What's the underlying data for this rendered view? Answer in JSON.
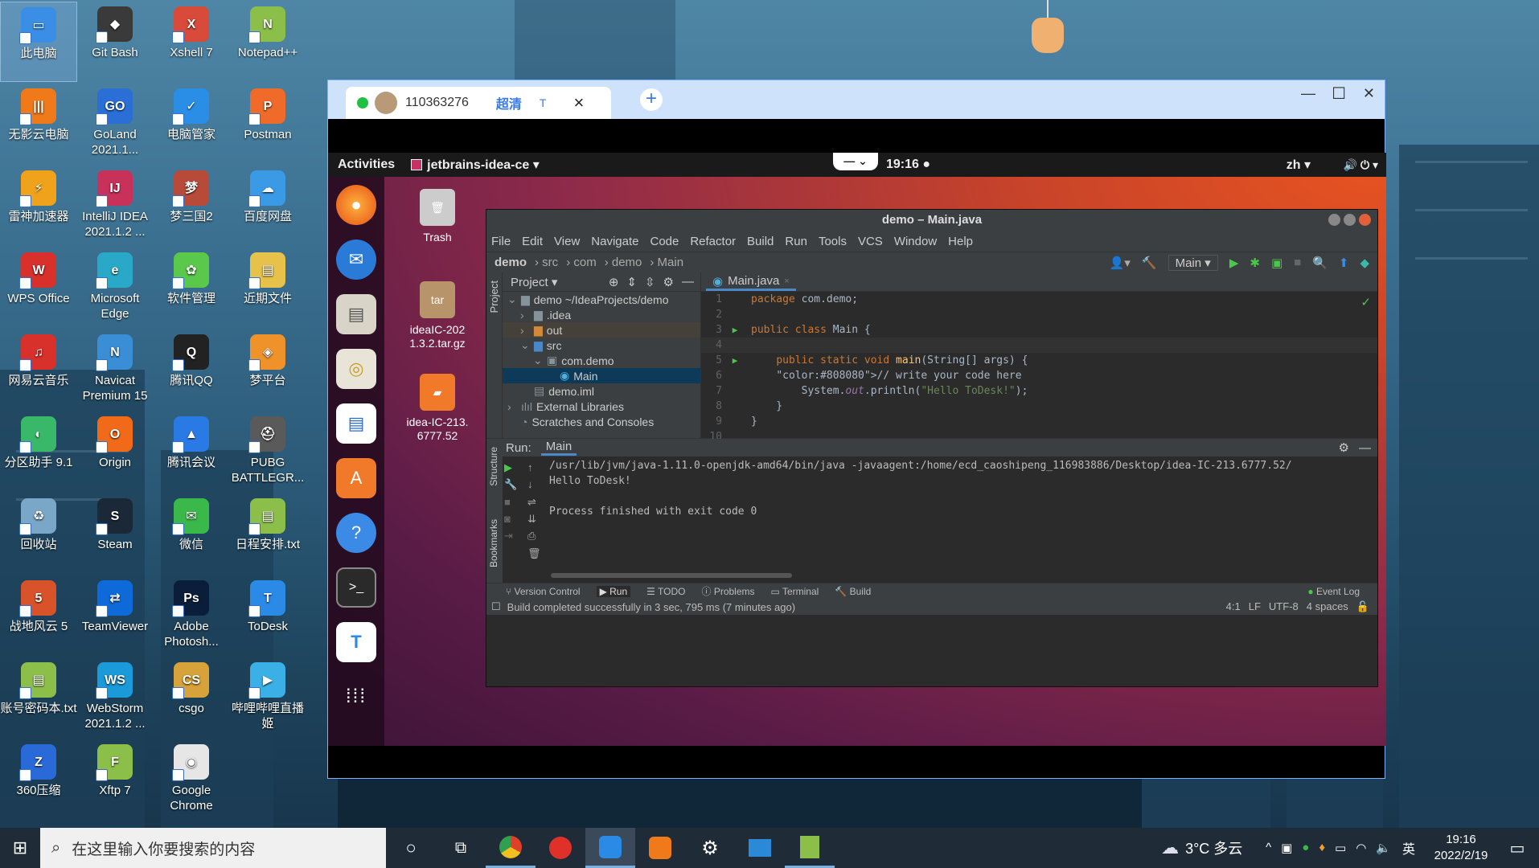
{
  "desktop": {
    "icons": [
      {
        "label": "此电脑",
        "color": "#3a8ee6",
        "glyph": "▭"
      },
      {
        "label": "Git Bash",
        "color": "#3a3a3a",
        "glyph": "◆"
      },
      {
        "label": "Xshell 7",
        "color": "#d84a3a",
        "glyph": "X"
      },
      {
        "label": "Notepad++",
        "color": "#8bbf4a",
        "glyph": "N"
      },
      {
        "label": "无影云电脑",
        "color": "#f07a1a",
        "glyph": "|||"
      },
      {
        "label": "GoLand 2021.1...",
        "color": "#2a6fd6",
        "glyph": "GO"
      },
      {
        "label": "电脑管家",
        "color": "#2a8ee6",
        "glyph": "✓"
      },
      {
        "label": "Postman",
        "color": "#f06a2a",
        "glyph": "P"
      },
      {
        "label": "雷神加速器",
        "color": "#f0a21a",
        "glyph": "⚡"
      },
      {
        "label": "IntelliJ IDEA 2021.1.2 ...",
        "color": "#c8325a",
        "glyph": "IJ"
      },
      {
        "label": "梦三国2",
        "color": "#b84a3a",
        "glyph": "梦"
      },
      {
        "label": "百度网盘",
        "color": "#3a9ae6",
        "glyph": "☁"
      },
      {
        "label": "WPS Office",
        "color": "#d8302a",
        "glyph": "W"
      },
      {
        "label": "Microsoft Edge",
        "color": "#2aa8c8",
        "glyph": "e"
      },
      {
        "label": "软件管理",
        "color": "#5ac84a",
        "glyph": "✿"
      },
      {
        "label": "近期文件",
        "color": "#e6c24a",
        "glyph": "▤"
      },
      {
        "label": "网易云音乐",
        "color": "#d8302a",
        "glyph": "♫"
      },
      {
        "label": "Navicat Premium 15",
        "color": "#3a8ed6",
        "glyph": "N"
      },
      {
        "label": "腾讯QQ",
        "color": "#222",
        "glyph": "Q"
      },
      {
        "label": "梦平台",
        "color": "#f0922a",
        "glyph": "◈"
      },
      {
        "label": "分区助手 9.1",
        "color": "#3ab86a",
        "glyph": "◐"
      },
      {
        "label": "Origin",
        "color": "#f06a1a",
        "glyph": "O"
      },
      {
        "label": "腾讯会议",
        "color": "#2a7ae6",
        "glyph": "▲"
      },
      {
        "label": "PUBG BATTLEGR...",
        "color": "#5a5a5a",
        "glyph": "⛑"
      },
      {
        "label": "回收站",
        "color": "#7aa6c8",
        "glyph": "♻"
      },
      {
        "label": "Steam",
        "color": "#1b2838",
        "glyph": "S"
      },
      {
        "label": "微信",
        "color": "#3ab84a",
        "glyph": "✉"
      },
      {
        "label": "日程安排.txt",
        "color": "#8bbf4a",
        "glyph": "▤"
      },
      {
        "label": "战地风云 5",
        "color": "#d8522a",
        "glyph": "5"
      },
      {
        "label": "TeamViewer",
        "color": "#0e6ad8",
        "glyph": "⇄"
      },
      {
        "label": "Adobe Photosh...",
        "color": "#0a1e3a",
        "glyph": "Ps"
      },
      {
        "label": "ToDesk",
        "color": "#2a8ae6",
        "glyph": "T"
      },
      {
        "label": "账号密码本.txt",
        "color": "#8bbf4a",
        "glyph": "▤"
      },
      {
        "label": "WebStorm 2021.1.2 ...",
        "color": "#1a9ad8",
        "glyph": "WS"
      },
      {
        "label": "csgo",
        "color": "#d8a23a",
        "glyph": "CS"
      },
      {
        "label": "哔哩哔哩直播姬",
        "color": "#3ab0e6",
        "glyph": "▶"
      },
      {
        "label": "360压缩",
        "color": "#2a6ad8",
        "glyph": "Z"
      },
      {
        "label": "Xftp 7",
        "color": "#8bbf4a",
        "glyph": "F"
      },
      {
        "label": "Google Chrome",
        "color": "#e6e6e6",
        "glyph": "◉"
      }
    ]
  },
  "todesk": {
    "session_id": "110363276",
    "quality": "超清",
    "quality_icon": "T",
    "add_tab_icon": "+",
    "close_tab_icon": "×",
    "min_icon": "—",
    "max_icon": "☐",
    "close_icon": "✕"
  },
  "ubuntu": {
    "activities": "Activities",
    "app_menu": "jetbrains-idea-ce ▾",
    "clock": "19:16 ●",
    "lang": "zh ▾",
    "tray": "🔊 ⏻ ▾",
    "desktop_items": [
      {
        "label": "Trash",
        "glyph": "🗑"
      },
      {
        "label": "ideaIC-2021.3.2.tar.gz",
        "glyph": "tar"
      },
      {
        "label": "idea-IC-213.6777.52",
        "glyph": "▰"
      }
    ]
  },
  "ide": {
    "title": "demo – Main.java",
    "menu": [
      "File",
      "Edit",
      "View",
      "Navigate",
      "Code",
      "Refactor",
      "Build",
      "Run",
      "Tools",
      "VCS",
      "Window",
      "Help"
    ],
    "breadcrumb": [
      "demo",
      "src",
      "com",
      "demo",
      "Main"
    ],
    "run_config": "Main ▾",
    "project_header": "Project ▾",
    "project_side": "Project",
    "tree": [
      {
        "label": "demo ~/IdeaProjects/demo",
        "depth": 0,
        "arrow": "⌄",
        "icon": "▆",
        "color": "#87939a",
        "sel": false
      },
      {
        "label": ".idea",
        "depth": 1,
        "arrow": "›",
        "icon": "▆",
        "color": "#87939a",
        "sel": false
      },
      {
        "label": "out",
        "depth": 1,
        "arrow": "›",
        "icon": "▆",
        "color": "#d28a3a",
        "sel": false
      },
      {
        "label": "src",
        "depth": 1,
        "arrow": "⌄",
        "icon": "▆",
        "color": "#4a88c7",
        "sel": false
      },
      {
        "label": "com.demo",
        "depth": 2,
        "arrow": "⌄",
        "icon": "▣",
        "color": "#87939a",
        "sel": false
      },
      {
        "label": "Main",
        "depth": 3,
        "arrow": "",
        "icon": "◉",
        "color": "#4ab0e0",
        "sel": true
      },
      {
        "label": "demo.iml",
        "depth": 1,
        "arrow": "",
        "icon": "▤",
        "color": "#87939a",
        "sel": false
      },
      {
        "label": "External Libraries",
        "depth": 0,
        "arrow": "›",
        "icon": "ılıl",
        "color": "#87939a",
        "sel": false
      },
      {
        "label": "Scratches and Consoles",
        "depth": 0,
        "arrow": "",
        "icon": "◔",
        "color": "#87939a",
        "sel": false
      }
    ],
    "editor_tab": "Main.java",
    "code": [
      {
        "n": "1",
        "t": "package com.demo;"
      },
      {
        "n": "2",
        "t": ""
      },
      {
        "n": "3",
        "t": "public class Main {"
      },
      {
        "n": "4",
        "t": ""
      },
      {
        "n": "5",
        "t": "    public static void main(String[] args) {"
      },
      {
        "n": "6",
        "t": "    // write your code here"
      },
      {
        "n": "7",
        "t": "        System.out.println(\"Hello ToDesk!\");"
      },
      {
        "n": "8",
        "t": "    }"
      },
      {
        "n": "9",
        "t": "}"
      },
      {
        "n": "10",
        "t": ""
      }
    ],
    "run_label": "Run:",
    "run_tab": "Main",
    "console": [
      "/usr/lib/jvm/java-1.11.0-openjdk-amd64/bin/java -javaagent:/home/ecd_caoshipeng_116983886/Desktop/idea-IC-213.6777.52/",
      "Hello ToDesk!",
      "",
      "Process finished with exit code 0"
    ],
    "side_structure": "Structure",
    "side_bookmarks": "Bookmarks",
    "bottom_tabs": [
      "Version Control",
      "Run",
      "TODO",
      "Problems",
      "Terminal",
      "Build"
    ],
    "event_log": "Event Log",
    "status_text": "Build completed successfully in 3 sec, 795 ms (7 minutes ago)",
    "status_right": [
      "4:1",
      "LF",
      "UTF-8",
      "4 spaces"
    ]
  },
  "taskbar": {
    "search_placeholder": "在这里输入你要搜索的内容",
    "weather": "3°C  多云",
    "ime": "英",
    "time": "19:16",
    "date": "2022/2/19"
  }
}
